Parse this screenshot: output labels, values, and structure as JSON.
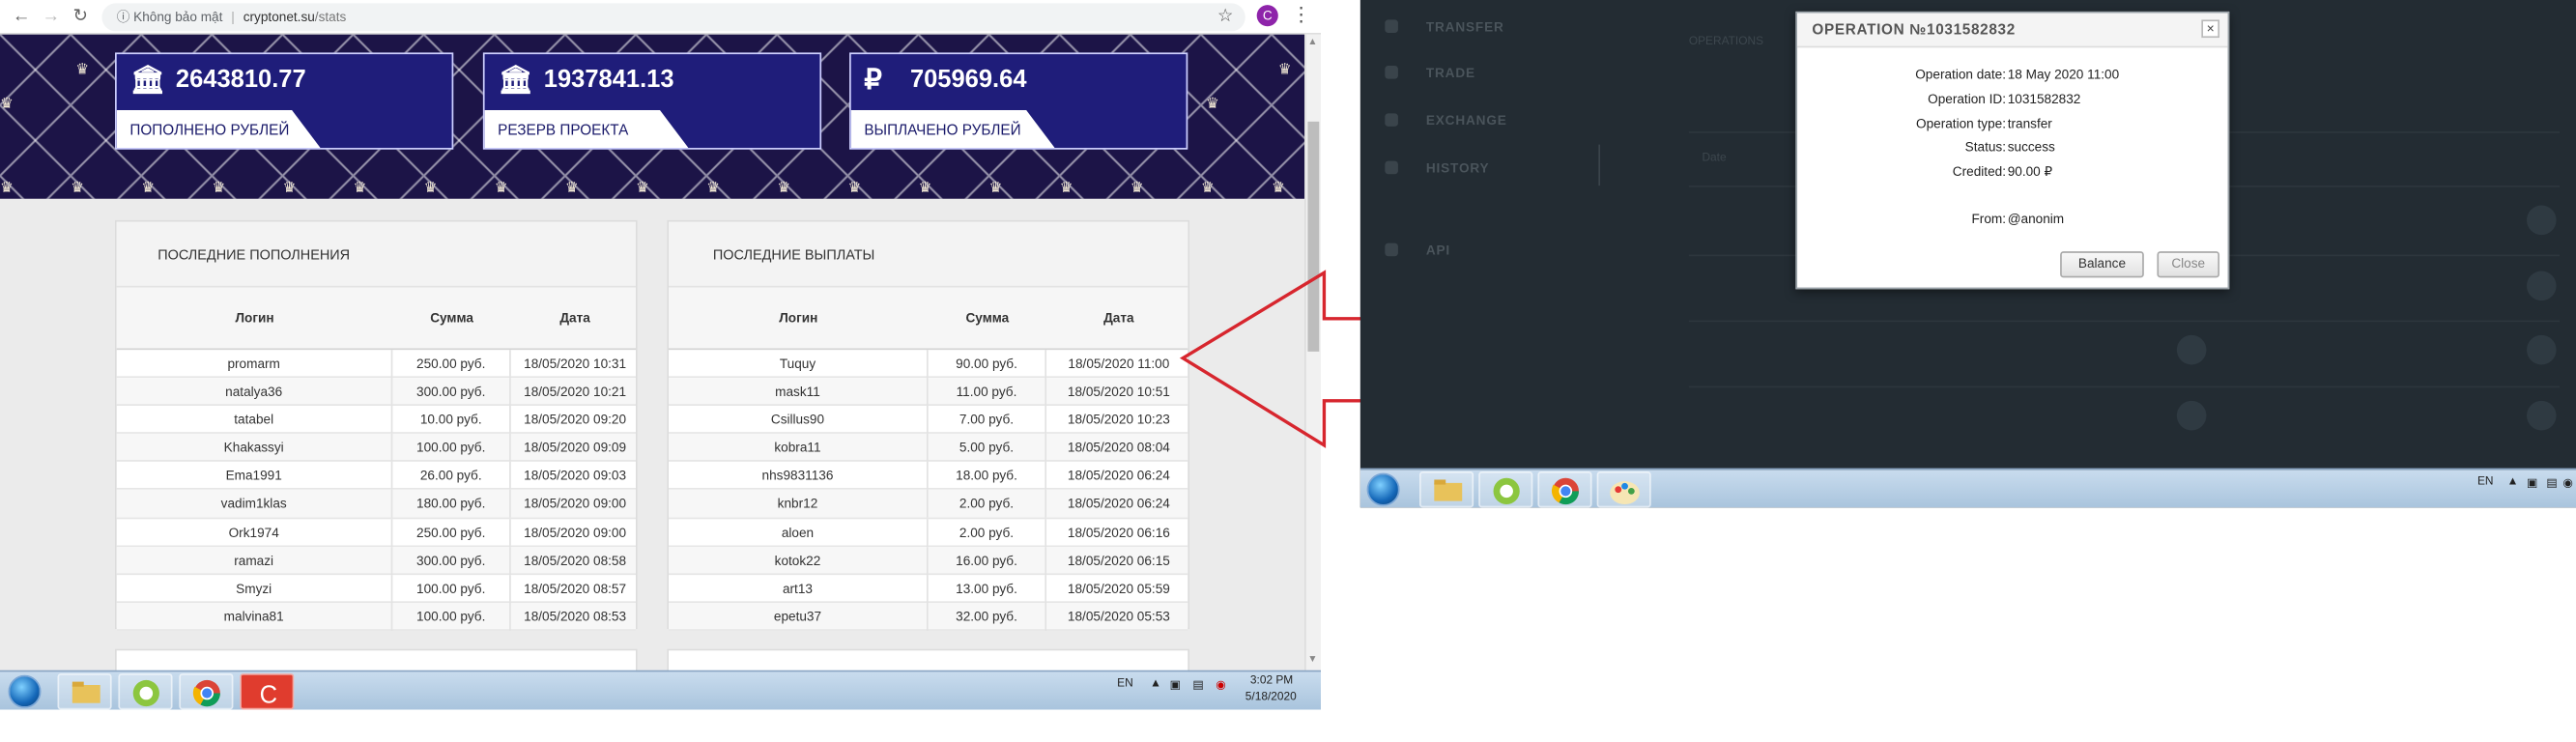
{
  "browser": {
    "security_label": "Không bảo mật",
    "domain": "cryptonet.su",
    "path": "/stats",
    "profile_initial": "C"
  },
  "stats": [
    {
      "icon": "bank-icon",
      "value": "2643810.77",
      "label": "ПОПОЛНЕНО РУБЛЕЙ"
    },
    {
      "icon": "bank-icon",
      "value": "1937841.13",
      "label": "РЕЗЕРВ ПРОЕКТА"
    },
    {
      "icon": "ruble-icon",
      "value": "705969.64",
      "label": "ВЫПЛАЧЕНО РУБЛЕЙ",
      "symbol": "₽"
    }
  ],
  "deposits": {
    "title": "ПОСЛЕДНИЕ ПОПОЛНЕНИЯ",
    "columns": [
      "Логин",
      "Сумма",
      "Дата"
    ],
    "rows": [
      [
        "promarm",
        "250.00 руб.",
        "18/05/2020 10:31"
      ],
      [
        "natalya36",
        "300.00 руб.",
        "18/05/2020 10:21"
      ],
      [
        "tatabel",
        "10.00 руб.",
        "18/05/2020 09:20"
      ],
      [
        "Khakassyi",
        "100.00 руб.",
        "18/05/2020 09:09"
      ],
      [
        "Ema1991",
        "26.00 руб.",
        "18/05/2020 09:03"
      ],
      [
        "vadim1klas",
        "180.00 руб.",
        "18/05/2020 09:00"
      ],
      [
        "Ork1974",
        "250.00 руб.",
        "18/05/2020 09:00"
      ],
      [
        "ramazi",
        "300.00 руб.",
        "18/05/2020 08:58"
      ],
      [
        "Smyzi",
        "100.00 руб.",
        "18/05/2020 08:57"
      ],
      [
        "malvina81",
        "100.00 руб.",
        "18/05/2020 08:53"
      ]
    ]
  },
  "payouts": {
    "title": "ПОСЛЕДНИЕ ВЫПЛАТЫ",
    "columns": [
      "Логин",
      "Сумма",
      "Дата"
    ],
    "rows": [
      [
        "Tuquy",
        "90.00 руб.",
        "18/05/2020 11:00"
      ],
      [
        "mask11",
        "11.00 руб.",
        "18/05/2020 10:51"
      ],
      [
        "Csillus90",
        "7.00 руб.",
        "18/05/2020 10:23"
      ],
      [
        "kobra11",
        "5.00 руб.",
        "18/05/2020 08:04"
      ],
      [
        "nhs9831136",
        "18.00 руб.",
        "18/05/2020 06:24"
      ],
      [
        "knbr12",
        "2.00 руб.",
        "18/05/2020 06:24"
      ],
      [
        "aloen",
        "2.00 руб.",
        "18/05/2020 06:16"
      ],
      [
        "kotok22",
        "16.00 руб.",
        "18/05/2020 06:15"
      ],
      [
        "art13",
        "13.00 руб.",
        "18/05/2020 05:59"
      ],
      [
        "epetu37",
        "32.00 руб.",
        "18/05/2020 05:53"
      ]
    ]
  },
  "taskbar_left": {
    "lang": "EN",
    "time": "3:02 PM",
    "date": "5/18/2020",
    "apps": [
      "folder-icon",
      "odnoklassniki-icon",
      "chrome-icon",
      "cashback-icon"
    ]
  },
  "sidebar_dark": {
    "items": [
      "TRANSFER",
      "TRADE",
      "EXCHANGE",
      "HISTORY",
      "API"
    ]
  },
  "dark_table": {
    "header_fragment": "OPERATIONS",
    "date_column": "Date"
  },
  "modal": {
    "title": "OPERATION №1031582832",
    "close_glyph": "×",
    "fields": [
      {
        "key": "Operation date:",
        "value": "18 May 2020 11:00"
      },
      {
        "key": "Operation ID:",
        "value": "1031582832"
      },
      {
        "key": "Operation type:",
        "value": "transfer"
      },
      {
        "key": "Status:",
        "value": "success"
      },
      {
        "key": "Credited:",
        "value": "90.00 ₽"
      },
      {
        "key": "From:",
        "value": "@anonim"
      }
    ],
    "balance_button": "Balance",
    "close_button": "Close"
  },
  "taskbar_right": {
    "lang": "EN",
    "apps": [
      "folder-icon",
      "odnoklassniki-icon",
      "chrome-icon",
      "paint-icon"
    ]
  },
  "colors": {
    "hero_bg": "#1c1447",
    "stat_box": "#1f1d7a",
    "arrow_red": "#d7262e",
    "dark_bg": "#232c33"
  }
}
